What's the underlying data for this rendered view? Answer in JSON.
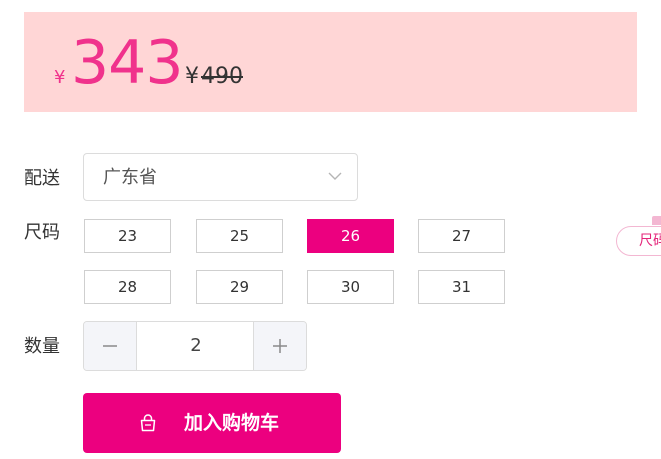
{
  "price": {
    "currency_symbol": "¥",
    "current": "343",
    "original_symbol": "¥",
    "original": "490"
  },
  "delivery": {
    "label": "配送",
    "selected_value": "广东省"
  },
  "size": {
    "label": "尺码",
    "options": [
      "23",
      "25",
      "26",
      "27",
      "28",
      "29",
      "30",
      "31"
    ],
    "selected": "26"
  },
  "side_tag": {
    "label": "尺码"
  },
  "quantity": {
    "label": "数量",
    "value": "2",
    "minus_symbol": "−",
    "plus_symbol": "+"
  },
  "cart": {
    "button_label": "加入购物车"
  },
  "icons": {
    "chevron": "chevron-down-icon",
    "minus": "minus-icon",
    "plus": "plus-icon",
    "cart": "shopping-bag-icon"
  },
  "colors": {
    "accent": "#ec007f",
    "price": "#f0328c",
    "panel_bg": "#ffd6d6"
  }
}
